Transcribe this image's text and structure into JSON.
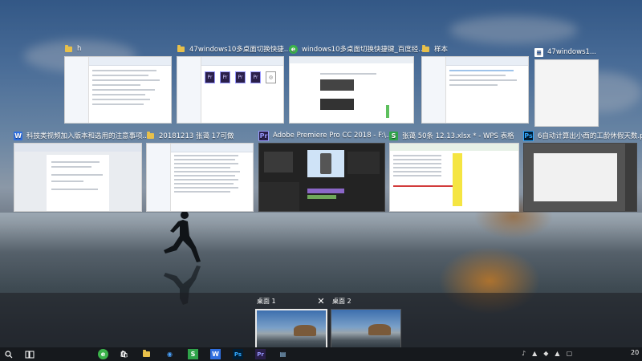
{
  "windows_row1": [
    {
      "title": "h",
      "icon": "folder-icon"
    },
    {
      "title": "47windows10多桌面切换快捷...",
      "icon": "folder-icon"
    },
    {
      "title": "windows10多桌面切换快捷键_百度经...",
      "icon": "360-browser-icon"
    },
    {
      "title": "样本",
      "icon": "folder-icon"
    },
    {
      "title": "47windows1...",
      "icon": "word-document-icon"
    }
  ],
  "windows_row2": [
    {
      "title": "科技类视频加入版本和选用的注意事项...",
      "icon": "wps-writer-icon"
    },
    {
      "title": "20181213 张蔼 17可做",
      "icon": "folder-icon"
    },
    {
      "title": "Adobe Premiere Pro CC 2018 - F:\\...",
      "icon": "premiere-icon",
      "icon_text": "Pr"
    },
    {
      "title": "张蔼 50条 12.13.xlsx * - WPS 表格",
      "icon": "wps-sheet-icon",
      "icon_text": "S"
    },
    {
      "title": "6自动计算出小西的工龄休假天数.psd...",
      "icon": "photoshop-icon",
      "icon_text": "Ps"
    }
  ],
  "desktops": [
    {
      "label": "桌面 1",
      "active": true
    },
    {
      "label": "桌面 2",
      "active": false
    }
  ],
  "close_label": "✕",
  "taskbar": {
    "clock": "20",
    "icons": [
      "start-icon",
      "search-icon",
      "task-view-icon",
      "360-browser-icon",
      "store-icon",
      "file-explorer-icon",
      "network-icon",
      "wps-sheet-icon",
      "wps-writer-icon",
      "photoshop-icon",
      "premiere-icon",
      "notepad-icon"
    ]
  },
  "colors": {
    "wps_writer": "#2f6fe0",
    "wps_sheet": "#2fa34a",
    "premiere": "#9999ff",
    "photoshop": "#31a8ff",
    "folder": "#e8c04a"
  }
}
